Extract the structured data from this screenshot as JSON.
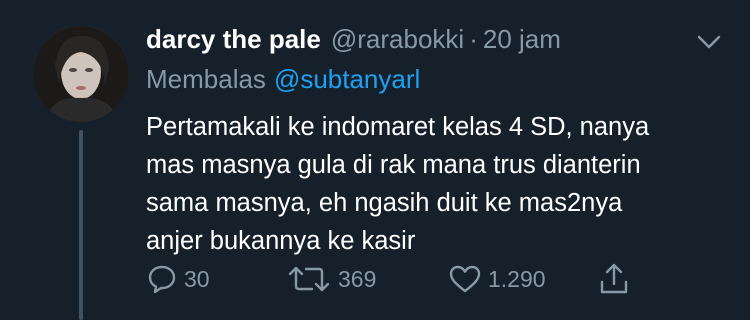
{
  "tweet": {
    "author_name": "darcy the pale",
    "handle": "@rarabokki",
    "separator": "·",
    "time": "20 jam",
    "reply_prefix": "Membalas",
    "reply_to": "@subtanyarl",
    "text_lines": [
      "Pertamakali ke indomaret kelas 4 SD, nanya",
      "mas masnya gula di rak mana trus dianterin",
      "sama masnya, eh ngasih duit ke mas2nya",
      "anjer bukannya ke kasir"
    ],
    "actions": {
      "reply_count": "30",
      "retweet_count": "369",
      "like_count": "1.290"
    }
  },
  "icons": {
    "menu": "chevron-down-icon",
    "reply": "speech-bubble-icon",
    "retweet": "retweet-arrows-icon",
    "like": "heart-icon",
    "share": "share-upload-icon"
  },
  "colors": {
    "background": "#15202b",
    "primary_text": "#ffffff",
    "secondary_text": "#8899a6",
    "link": "#1da1f2",
    "thread_line": "#3d5466"
  }
}
